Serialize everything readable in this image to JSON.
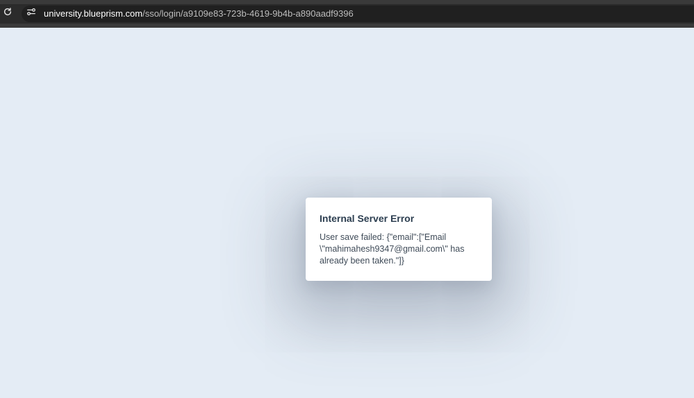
{
  "browser": {
    "url_host": "university.blueprism.com",
    "url_path": "/sso/login/a9109e83-723b-4619-9b4b-a890aadf9396",
    "reload_icon": "reload-icon",
    "site_info_icon": "site-info-icon"
  },
  "dialog": {
    "title": "Internal Server Error",
    "message": "User save failed: {\"email\":[\"Email \\\"mahimahesh9347@gmail.com\\\" has already been taken.\"]}"
  },
  "colors": {
    "page_background": "#e4ecf5",
    "toolbar": "#2b2b2b",
    "dialog_background": "#ffffff",
    "title_text": "#2c3e50"
  }
}
